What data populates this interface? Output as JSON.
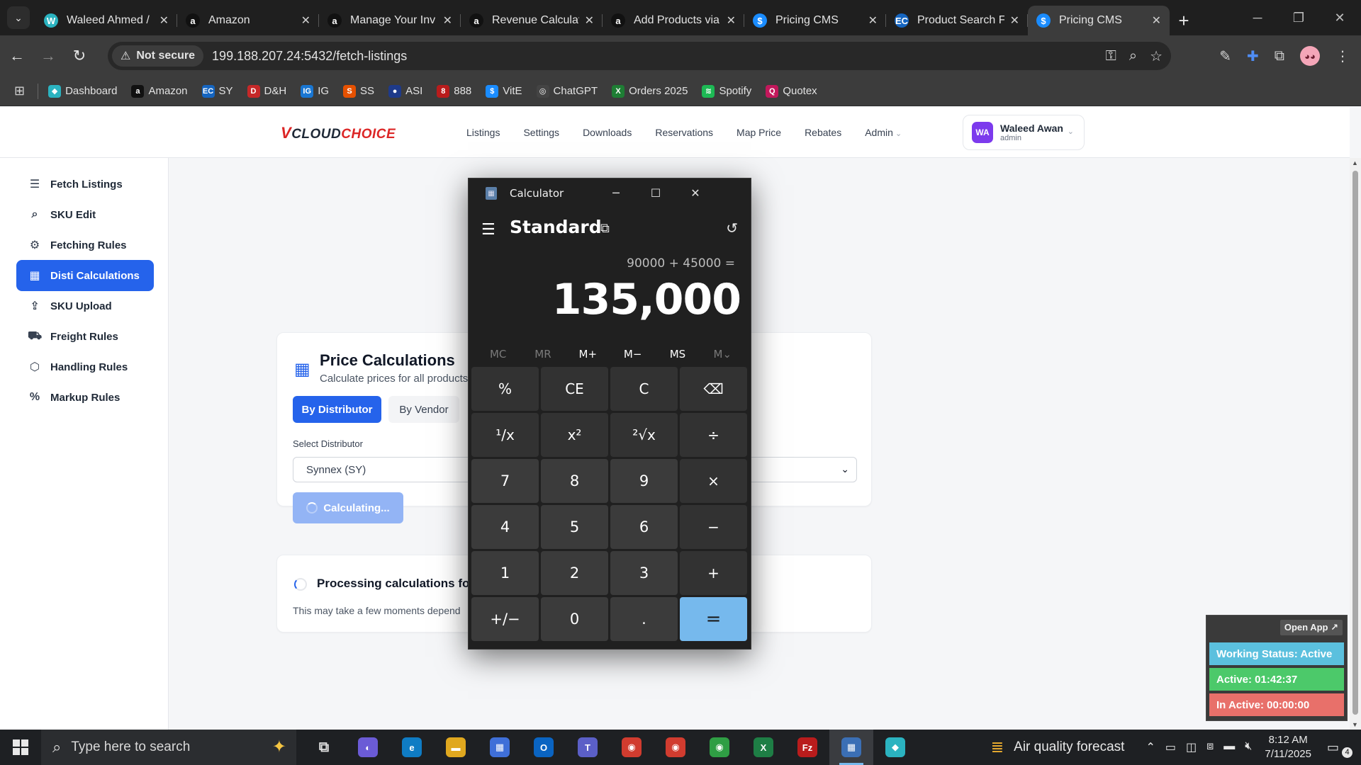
{
  "browser": {
    "tabs": [
      {
        "title": "Waleed Ahmed /",
        "favicon": "W",
        "color": "#2bb3c0"
      },
      {
        "title": "Amazon",
        "favicon": "a",
        "color": "#111111"
      },
      {
        "title": "Manage Your Inv",
        "favicon": "a",
        "color": "#111111"
      },
      {
        "title": "Revenue Calculat",
        "favicon": "a",
        "color": "#111111"
      },
      {
        "title": "Add Products via",
        "favicon": "a",
        "color": "#111111"
      },
      {
        "title": "Pricing CMS",
        "favicon": "$",
        "color": "#1a8cff"
      },
      {
        "title": "Product Search F",
        "favicon": "EC",
        "color": "#1565c0"
      },
      {
        "title": "Pricing CMS",
        "favicon": "$",
        "color": "#1a8cff",
        "active": true
      }
    ],
    "security_label": "Not secure",
    "url": "199.188.207.24:5432/fetch-listings",
    "bookmarks": [
      {
        "label": "Dashboard",
        "icon": "◆",
        "color": "#2bb3c0"
      },
      {
        "label": "Amazon",
        "icon": "a",
        "color": "#111111"
      },
      {
        "label": "SY",
        "icon": "EC",
        "color": "#1565c0"
      },
      {
        "label": "D&H",
        "icon": "D",
        "color": "#c62828"
      },
      {
        "label": "IG",
        "icon": "IG",
        "color": "#1976d2"
      },
      {
        "label": "SS",
        "icon": "S",
        "color": "#e65100"
      },
      {
        "label": "ASI",
        "icon": "●",
        "color": "#1e3a8a"
      },
      {
        "label": "888",
        "icon": "8",
        "color": "#b91c1c"
      },
      {
        "label": "VitE",
        "icon": "$",
        "color": "#1a8cff"
      },
      {
        "label": "ChatGPT",
        "icon": "◎",
        "color": "#444444"
      },
      {
        "label": "Orders 2025",
        "icon": "X",
        "color": "#1e7e34"
      },
      {
        "label": "Spotify",
        "icon": "≋",
        "color": "#1db954"
      },
      {
        "label": "Quotex",
        "icon": "Q",
        "color": "#c2185b"
      }
    ]
  },
  "app": {
    "logo_v": "V",
    "logo_cloud": "CLOUD",
    "logo_choice": "CHOICE",
    "nav": [
      "Listings",
      "Settings",
      "Downloads",
      "Reservations",
      "Map Price",
      "Rebates",
      "Admin"
    ],
    "user": {
      "initials": "WA",
      "name": "Waleed Awan",
      "role": "admin"
    },
    "sidebar": [
      {
        "label": "Fetch Listings",
        "icon": "☰"
      },
      {
        "label": "SKU Edit",
        "icon": "⌕"
      },
      {
        "label": "Fetching Rules",
        "icon": "⚙"
      },
      {
        "label": "Disti Calculations",
        "icon": "▦",
        "active": true
      },
      {
        "label": "SKU Upload",
        "icon": "⇪"
      },
      {
        "label": "Freight Rules",
        "icon": "⛟"
      },
      {
        "label": "Handling Rules",
        "icon": "⬡"
      },
      {
        "label": "Markup Rules",
        "icon": "%"
      }
    ],
    "price_card": {
      "title": "Price Calculations",
      "subtitle": "Calculate prices for all products",
      "tab_distributor": "By Distributor",
      "tab_vendor": "By Vendor",
      "select_label": "Select Distributor",
      "select_value": "Synnex (SY)",
      "calc_button": "Calculating..."
    },
    "processing": {
      "title": "Processing calculations for S",
      "subtitle": "This may take a few moments depend"
    }
  },
  "calculator": {
    "window_title": "Calculator",
    "mode": "Standard",
    "expression": "90000 + 45000 =",
    "result": "135,000",
    "memory": [
      {
        "label": "MC",
        "enabled": false
      },
      {
        "label": "MR",
        "enabled": false
      },
      {
        "label": "M+",
        "enabled": true
      },
      {
        "label": "M−",
        "enabled": true
      },
      {
        "label": "MS",
        "enabled": true
      },
      {
        "label": "M⌄",
        "enabled": false
      }
    ],
    "keys": [
      {
        "label": "%",
        "kind": "fn",
        "name": "percent-key"
      },
      {
        "label": "CE",
        "kind": "fn",
        "name": "clear-entry-key"
      },
      {
        "label": "C",
        "kind": "fn",
        "name": "clear-key"
      },
      {
        "label": "⌫",
        "kind": "fn",
        "name": "backspace-key"
      },
      {
        "label": "¹/x",
        "kind": "fn",
        "name": "reciprocal-key"
      },
      {
        "label": "x²",
        "kind": "fn",
        "name": "square-key"
      },
      {
        "label": "²√x",
        "kind": "fn",
        "name": "square-root-key"
      },
      {
        "label": "÷",
        "kind": "fn",
        "name": "divide-key"
      },
      {
        "label": "7",
        "kind": "num",
        "name": "digit-7-key"
      },
      {
        "label": "8",
        "kind": "num",
        "name": "digit-8-key"
      },
      {
        "label": "9",
        "kind": "num",
        "name": "digit-9-key"
      },
      {
        "label": "×",
        "kind": "fn",
        "name": "multiply-key"
      },
      {
        "label": "4",
        "kind": "num",
        "name": "digit-4-key"
      },
      {
        "label": "5",
        "kind": "num",
        "name": "digit-5-key"
      },
      {
        "label": "6",
        "kind": "num",
        "name": "digit-6-key"
      },
      {
        "label": "−",
        "kind": "fn",
        "name": "minus-key"
      },
      {
        "label": "1",
        "kind": "num",
        "name": "digit-1-key"
      },
      {
        "label": "2",
        "kind": "num",
        "name": "digit-2-key"
      },
      {
        "label": "3",
        "kind": "num",
        "name": "digit-3-key"
      },
      {
        "label": "+",
        "kind": "fn",
        "name": "plus-key"
      },
      {
        "label": "+/−",
        "kind": "num",
        "name": "negate-key"
      },
      {
        "label": "0",
        "kind": "num",
        "name": "digit-0-key"
      },
      {
        "label": ".",
        "kind": "num",
        "name": "decimal-key"
      },
      {
        "label": "=",
        "kind": "eq",
        "name": "equals-key"
      }
    ]
  },
  "status_widget": {
    "open_app": "Open App ↗",
    "working": "Working Status: Active",
    "active": "Active: 01:42:37",
    "inactive": "In Active: 00:00:00",
    "colors": {
      "working": "#5bc0de",
      "active": "#4cc96a",
      "inactive": "#e8706a"
    }
  },
  "taskbar": {
    "search_placeholder": "Type here to search",
    "apps": [
      {
        "name": "task-view-icon",
        "icon": "⧉",
        "color": "transparent"
      },
      {
        "name": "copilot-icon",
        "icon": "◐",
        "color": "#6b5bd6"
      },
      {
        "name": "edge-icon",
        "icon": "e",
        "color": "#0f7cc4"
      },
      {
        "name": "file-explorer-icon",
        "icon": "▬",
        "color": "#e0a81f"
      },
      {
        "name": "store-icon",
        "icon": "▦",
        "color": "#3f6fd8"
      },
      {
        "name": "outlook-icon",
        "icon": "O",
        "color": "#0a64c2"
      },
      {
        "name": "teams-icon",
        "icon": "T",
        "color": "#5b5fc7"
      },
      {
        "name": "chrome-icon",
        "icon": "◉",
        "color": "#d13c2f"
      },
      {
        "name": "chrome-profile-icon",
        "icon": "◉",
        "color": "#d13c2f"
      },
      {
        "name": "chrome-alt-icon",
        "icon": "◉",
        "color": "#2f9e44"
      },
      {
        "name": "excel-icon",
        "icon": "X",
        "color": "#1e7e45"
      },
      {
        "name": "filezilla-icon",
        "icon": "Fz",
        "color": "#b91c1c"
      },
      {
        "name": "calculator-icon",
        "icon": "▦",
        "color": "#3b6fb5",
        "active": true
      },
      {
        "name": "tracker-app-icon",
        "icon": "◆",
        "color": "#2bb3c0"
      }
    ],
    "weather": "Air quality forecast",
    "time": "8:12 AM",
    "date": "7/11/2025",
    "notifications": "4"
  }
}
